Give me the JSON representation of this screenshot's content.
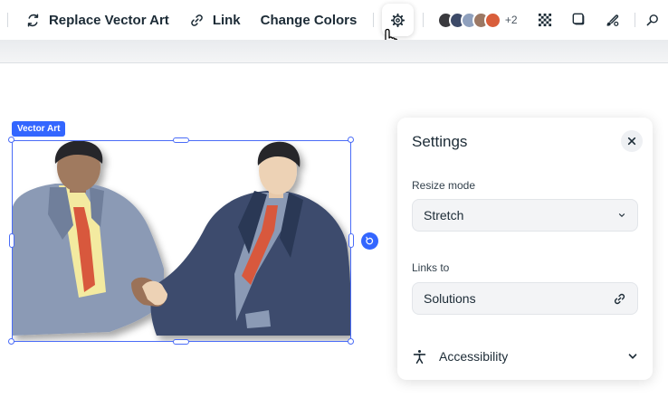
{
  "toolbar": {
    "replace_label": "Replace Vector Art",
    "link_label": "Link",
    "change_colors_label": "Change Colors",
    "swatches": [
      "#3a3a3e",
      "#3d4a68",
      "#8fa0bd",
      "#9c7864",
      "#d95e3b"
    ],
    "swatch_more": "+2"
  },
  "canvas": {
    "element_tag": "Vector Art",
    "selection_color": "#4a6cf7"
  },
  "settings": {
    "title": "Settings",
    "resize_mode": {
      "label": "Resize mode",
      "value": "Stretch"
    },
    "links_to": {
      "label": "Links to",
      "value": "Solutions"
    },
    "accessibility_label": "Accessibility"
  }
}
